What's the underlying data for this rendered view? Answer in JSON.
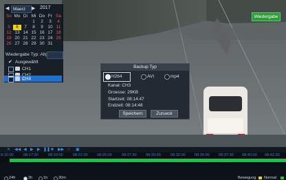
{
  "calendar": {
    "month": "Maerz",
    "year": "2017",
    "weekdays": [
      "So",
      "Mo",
      "Di",
      "Mi",
      "Do",
      "Fr",
      "Sa"
    ],
    "weeks": [
      [
        "",
        "",
        "",
        "1",
        "2",
        "3",
        "4"
      ],
      [
        "5",
        "6",
        "7",
        "8",
        "9",
        "10",
        "11"
      ],
      [
        "12",
        "13",
        "14",
        "15",
        "16",
        "17",
        "18"
      ],
      [
        "19",
        "20",
        "21",
        "22",
        "23",
        "24",
        "25"
      ],
      [
        "26",
        "27",
        "28",
        "29",
        "30",
        "31",
        ""
      ]
    ],
    "highlighted_day": "6"
  },
  "playback_type": {
    "label": "Wiedergabe Typ",
    "value": "Allgemein"
  },
  "channels": {
    "all_label": "Ausgewählt",
    "items": [
      {
        "label": "CH1",
        "selected": false
      },
      {
        "label": "CH2",
        "selected": false
      },
      {
        "label": "CH3",
        "selected": true
      },
      {
        "label": "CH4",
        "selected": false
      }
    ]
  },
  "playback_button": "Wiedergabe",
  "dialog": {
    "title": "Backup Typ",
    "formats": [
      {
        "label": "H264",
        "selected": true
      },
      {
        "label": "AVI",
        "selected": false
      },
      {
        "label": "mp4",
        "selected": false
      }
    ],
    "fields": [
      {
        "label": "Kanal",
        "value": "CH3"
      },
      {
        "label": "Groesse",
        "value": "29KB"
      },
      {
        "label": "Startzeit",
        "value": "08:14:47"
      },
      {
        "label": "Endzeit",
        "value": "08:14:48"
      }
    ],
    "save_label": "Speichern",
    "back_label": "Zurueck"
  },
  "timeline": {
    "times": [
      "8:15:00",
      "08:17:30",
      "08:20:00",
      "08:22:30",
      "08:25:00",
      "08:27:30",
      "08:30:00",
      "08:32:30",
      "08:35:00",
      "08:37:30",
      "08:40:00",
      "08:42:30"
    ],
    "zoom": [
      {
        "label": "24h",
        "selected": false
      },
      {
        "label": "2h",
        "selected": true
      },
      {
        "label": "1h",
        "selected": false
      },
      {
        "label": "30m",
        "selected": false
      }
    ]
  },
  "legend": {
    "motion": "Bewegung",
    "normal": "Normal"
  },
  "colors": {
    "accent": "#1f6fd1",
    "recording": "#1ec24a",
    "motion": "#f1d21a"
  }
}
